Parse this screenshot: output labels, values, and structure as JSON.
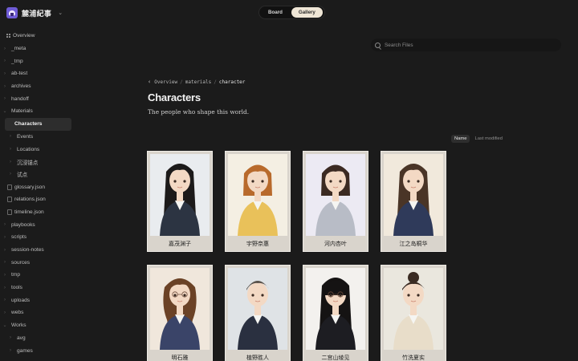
{
  "app": {
    "name": "麓浦紀事"
  },
  "view_toggle": {
    "board": "Board",
    "gallery": "Gallery",
    "active": "gallery"
  },
  "search": {
    "placeholder": "Search Files"
  },
  "sidebar": {
    "items": [
      {
        "label": "Overview",
        "type": "overview"
      },
      {
        "label": "_meta",
        "type": "folder"
      },
      {
        "label": "_tmp",
        "type": "folder"
      },
      {
        "label": "ab-test",
        "type": "folder"
      },
      {
        "label": "archives",
        "type": "folder"
      },
      {
        "label": "handoff",
        "type": "folder"
      },
      {
        "label": "Materials",
        "type": "folder-open"
      },
      {
        "label": "Characters",
        "type": "active"
      },
      {
        "label": "Events",
        "type": "child"
      },
      {
        "label": "Locations",
        "type": "child"
      },
      {
        "label": "沉浸锚点",
        "type": "child"
      },
      {
        "label": "试点",
        "type": "child"
      },
      {
        "label": "glossary.json",
        "type": "file"
      },
      {
        "label": "relations.json",
        "type": "file"
      },
      {
        "label": "timeline.json",
        "type": "file"
      },
      {
        "label": "playbooks",
        "type": "folder"
      },
      {
        "label": "scripts",
        "type": "folder"
      },
      {
        "label": "session-notes",
        "type": "folder"
      },
      {
        "label": "sources",
        "type": "folder"
      },
      {
        "label": "tmp",
        "type": "folder"
      },
      {
        "label": "tools",
        "type": "folder"
      },
      {
        "label": "uploads",
        "type": "folder"
      },
      {
        "label": "webs",
        "type": "folder"
      },
      {
        "label": "Works",
        "type": "folder-open"
      },
      {
        "label": "avg",
        "type": "child"
      },
      {
        "label": "games",
        "type": "child"
      }
    ]
  },
  "breadcrumb": {
    "items": [
      "Overview",
      "materials",
      "character"
    ]
  },
  "page": {
    "title": "Characters",
    "subtitle": "The people who shape this world."
  },
  "sort": {
    "name": "Name",
    "last_modified": "Last modified"
  },
  "gallery": {
    "cards": [
      {
        "name": "嘉茂渊子",
        "hair": "#1c1a1a",
        "outfit": "#2c3442",
        "bg": "#e9ecef",
        "style": "long"
      },
      {
        "name": "宇野奈惠",
        "hair": "#b86a2c",
        "outfit": "#e9c15a",
        "bg": "#f4efe3",
        "style": "bob"
      },
      {
        "name": "河内杏叶",
        "hair": "#3b2a22",
        "outfit": "#b8bcc6",
        "bg": "#eceaf3",
        "style": "bob"
      },
      {
        "name": "江之岛桐华",
        "hair": "#4a3527",
        "outfit": "#2f3a5a",
        "bg": "#f1e9dc",
        "style": "long"
      },
      {
        "name": "明石雅",
        "hair": "#6b4226",
        "outfit": "#3a4468",
        "bg": "#f0e7dc",
        "style": "wave"
      },
      {
        "name": "植野胜人",
        "hair": "#5a534c",
        "outfit": "#2a3040",
        "bg": "#dfe3e6",
        "style": "short"
      },
      {
        "name": "二宫山绫见",
        "hair": "#151313",
        "outfit": "#1d1d22",
        "bg": "#f3f1ee",
        "style": "hime"
      },
      {
        "name": "竹洗夏实",
        "hair": "#3a2b22",
        "outfit": "#e8ddc9",
        "bg": "#eae7de",
        "style": "updo"
      }
    ]
  },
  "colors": {
    "bg": "#1b1b1b",
    "active_item": "#2d2d2d",
    "toggle_on": "#efe6d6",
    "accent_logo": "#6f5cd6"
  }
}
